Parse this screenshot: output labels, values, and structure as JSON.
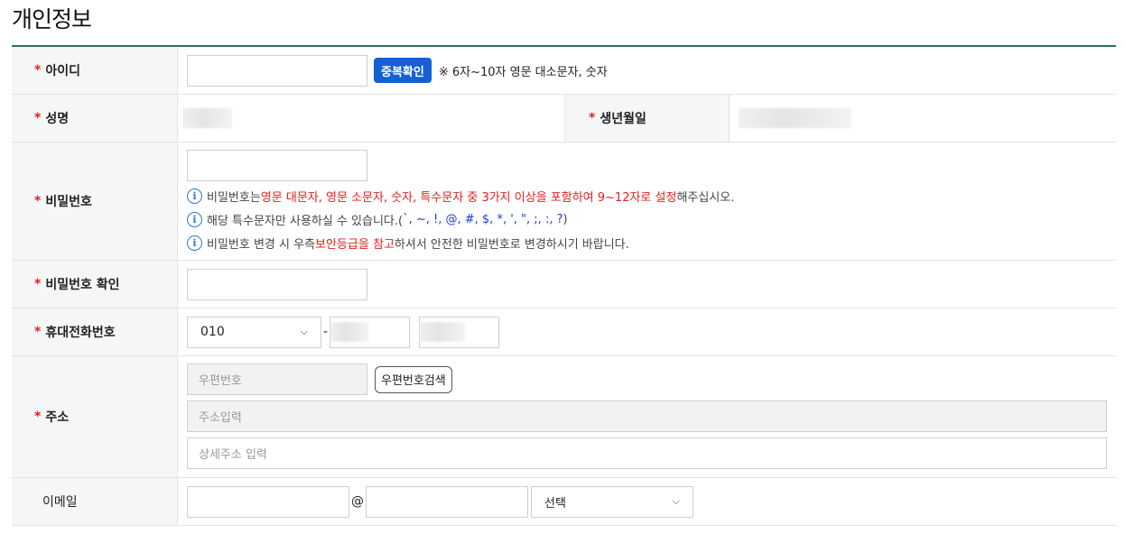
{
  "title": "개인정보",
  "required_mark": "*",
  "rows": {
    "id": {
      "label": "아이디",
      "input_value": "",
      "check_button": "중복확인",
      "hint": "※ 6자~10자 영문 대소문자, 숫자"
    },
    "name": {
      "label": "성명",
      "birth_label": "생년월일"
    },
    "password": {
      "label": "비밀번호",
      "info1": {
        "a": "비밀번호는 ",
        "b": "영문 대문자, 영문 소문자, 숫자, 특수문자 중 3가지 이상을 포함하여 9~12자로 설정",
        "c": "해주십시오."
      },
      "info2": {
        "a": "해당 특수문자만 사용하실 수 있습니다.(",
        "b": " `, ~, !, @, #, $, *, ', \", ;, :, ?",
        "c": ")"
      },
      "info3": {
        "a": "비밀번호 변경 시 우측 ",
        "b": "보안등급을 참고",
        "c": "하셔서 안전한 비밀번호로 변경하시기 바랍니다."
      }
    },
    "password_confirm": {
      "label": "비밀번호 확인"
    },
    "phone": {
      "label": "휴대전화번호",
      "prefix": "010",
      "dash": "-"
    },
    "address": {
      "label": "주소",
      "zip_placeholder": "우편번호",
      "zip_button": "우편번호검색",
      "addr_placeholder": "주소입력",
      "detail_placeholder": "상세주소 입력"
    },
    "email": {
      "label": "이메일",
      "at": "@",
      "domain_select": "선택"
    }
  },
  "icons": {
    "info": "info-icon",
    "dropdown": "chevron-down-icon"
  },
  "colors": {
    "accent": "#1560d4",
    "required": "#e21e1e",
    "header_border": "#2f6f5a"
  }
}
